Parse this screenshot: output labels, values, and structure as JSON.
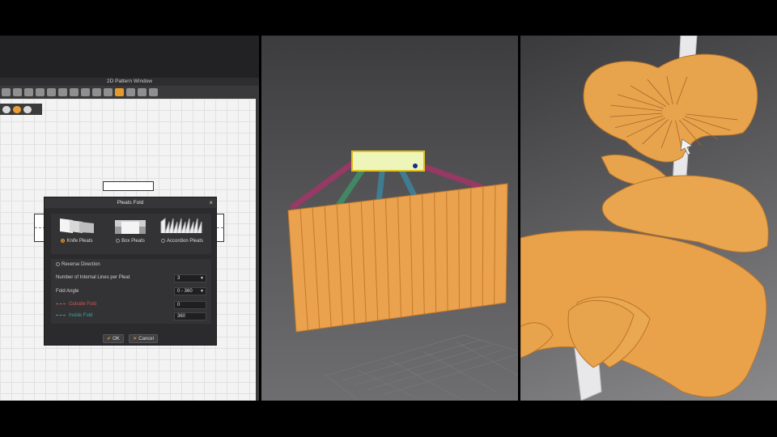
{
  "window": {
    "pattern_window_title": "2D Pattern Window"
  },
  "dialog": {
    "title": "Pleats Fold",
    "close_label": "×",
    "types": [
      {
        "label": "Knife Pleats",
        "selected": true
      },
      {
        "label": "Box Pleats",
        "selected": false
      },
      {
        "label": "Accordion Pleats",
        "selected": false
      }
    ],
    "reverse_direction_label": "Reverse Direction",
    "internal_lines_label": "Number of Internal Lines per Pleat",
    "internal_lines_value": "3",
    "fold_angle_label": "Fold Angle",
    "fold_angle_value": "0 - 360",
    "outside_fold_label": "Outside Fold",
    "outside_fold_value": "0",
    "inside_fold_label": "Inside Fold",
    "inside_fold_value": "360",
    "ok_label": "OK",
    "cancel_label": "Cancel"
  },
  "colors": {
    "accent": "#e8a035",
    "outside_fold": "#d9534f",
    "inside_fold": "#3aa6a0",
    "fabric": "#eaa24e"
  }
}
